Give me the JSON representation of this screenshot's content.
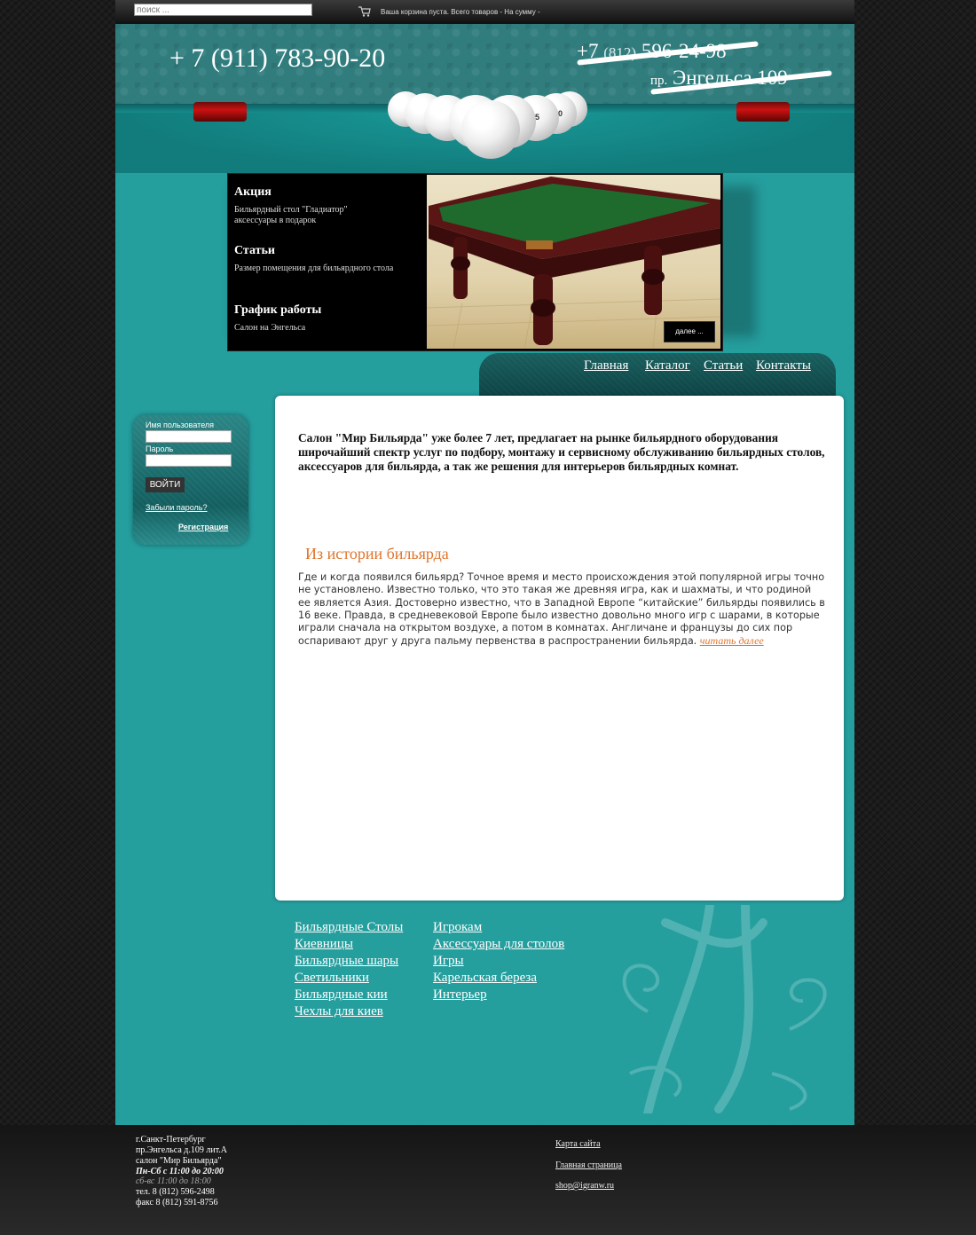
{
  "topbar": {
    "search_placeholder": "поиск ...",
    "cart_text": "Ваша корзина пуста. Всего товаров - На сумму -"
  },
  "header": {
    "phone": "+ 7 (911) 783-90-20",
    "old_phone_prefix": "+7",
    "old_phone_code": "(812)",
    "old_phone_number": "596-24-98",
    "old_addr_prefix": "пр.",
    "old_addr": "Энгельса 109",
    "balls": [
      "25",
      "25",
      "10"
    ]
  },
  "slider": {
    "items": [
      {
        "title": "Акция",
        "text": "Бильярдный стол \"Гладиатор\" аксессуары в подарок"
      },
      {
        "title": "Статьи",
        "text": "Размер помещения для бильярдного стола"
      },
      {
        "title": "График работы",
        "text": "Салон на Энгельса"
      }
    ],
    "more_label": "далее ..."
  },
  "nav": {
    "items": [
      "Главная",
      "Каталог",
      "Статьи",
      "Контакты"
    ]
  },
  "login": {
    "username_label": "Имя пользователя",
    "password_label": "Пароль",
    "submit_label": "ВОЙТИ",
    "forgot_label": "Забыли пароль?",
    "register_label": "Регистрация"
  },
  "content": {
    "intro": "Салон \"Мир Бильярда\" уже более 7 лет, предлагает на рынке бильярдного оборудования широчайший спектр услуг по подбору, монтажу и сервисному обслуживанию бильярдных столов, аксессуаров для бильярда, а так же решения для интерьеров бильярдных комнат.",
    "history_title": "Из истории бильярда",
    "history_text": "Где и когда появился бильярд? Точное время и место происхождения этой популярной игры точно не установлено. Известно только, что это такая же древняя игра, как и шахматы, и что родиной ее является Азия. Достоверно известно, что в Западной Европе “китайские” бильярды появились в 16 веке. Правда, в средневековой Европе было известно довольно много игр с шарами, в которые играли сначала на открытом воздухе, а потом в комнатах. Англичане и французы до сих пор оспаривают друг у друга пальму первенства в распространении бильярда. ",
    "read_more": "читать далее"
  },
  "catalog_links": {
    "col1": [
      "Бильярдные Столы",
      "Киевницы",
      "Бильярдные шары",
      "Светильники",
      "Бильярдные кии",
      "Чехлы для киев"
    ],
    "col2": [
      "Игрокам",
      "Аксессуары для столов",
      "Игры",
      "Карельская береза",
      "Интерьер"
    ]
  },
  "footer": {
    "city": "г.Санкт-Петербург",
    "address": "пр.Энгельса д.109 лит.А",
    "salon": "салон \"Мир Бильярда\"",
    "hours_weekdays": "Пн-Сб с 11:00 до 20:00",
    "hours_weekend": "сб-вс 11:00 до 18:00",
    "tel": "тел.  8 (812) 596-2498",
    "fax": "факс 8 (812) 591-8756",
    "links": [
      "Карта сайта",
      "Главная страница",
      "shop@igranw.ru"
    ]
  },
  "colors": {
    "teal": "#259e9e",
    "accent_orange": "#e0752c",
    "dark_bg": "#1b1b1b"
  }
}
